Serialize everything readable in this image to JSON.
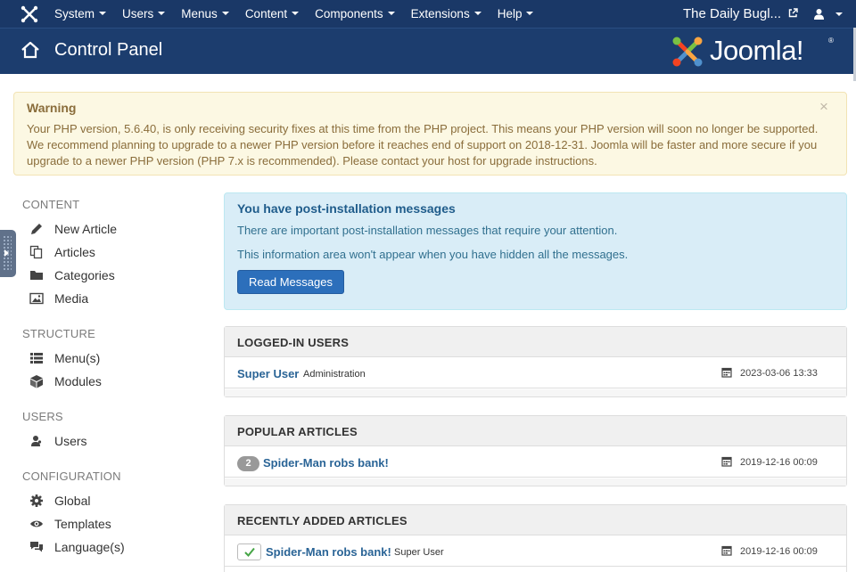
{
  "topbar": {
    "menu": [
      {
        "label": "System"
      },
      {
        "label": "Users"
      },
      {
        "label": "Menus"
      },
      {
        "label": "Content"
      },
      {
        "label": "Components"
      },
      {
        "label": "Extensions"
      },
      {
        "label": "Help"
      }
    ],
    "site_name": "The Daily Bugl...",
    "user_icon": "user-icon",
    "background": "#1a3867"
  },
  "header": {
    "title": "Control Panel",
    "brand": "Joomla!",
    "brand_reg": "®"
  },
  "warning": {
    "title": "Warning",
    "message": "Your PHP version, 5.6.40, is only receiving security fixes at this time from the PHP project. This means your PHP version will soon no longer be supported. We recommend planning to upgrade to a newer PHP version before it reaches end of support on 2018-12-31. Joomla will be faster and more secure if you upgrade to a newer PHP version (PHP 7.x is recommended). Please contact your host for upgrade instructions.",
    "close": "×"
  },
  "sidebar": {
    "content_heading": "CONTENT",
    "content_items": [
      {
        "label": "New Article",
        "icon": "pencil-icon"
      },
      {
        "label": "Articles",
        "icon": "copy-icon"
      },
      {
        "label": "Categories",
        "icon": "folder-icon"
      },
      {
        "label": "Media",
        "icon": "image-icon"
      }
    ],
    "structure_heading": "STRUCTURE",
    "structure_items": [
      {
        "label": "Menu(s)",
        "icon": "list-icon"
      },
      {
        "label": "Modules",
        "icon": "cube-icon"
      }
    ],
    "users_heading": "USERS",
    "users_items": [
      {
        "label": "Users",
        "icon": "users-icon"
      }
    ],
    "config_heading": "CONFIGURATION",
    "config_items": [
      {
        "label": "Global",
        "icon": "cog-icon"
      },
      {
        "label": "Templates",
        "icon": "eye-icon"
      },
      {
        "label": "Language(s)",
        "icon": "comments-icon"
      }
    ]
  },
  "postinstall": {
    "title": "You have post-installation messages",
    "line1": "There are important post-installation messages that require your attention.",
    "line2": "This information area won't appear when you have hidden all the messages.",
    "button": "Read Messages"
  },
  "logged_in": {
    "heading": "LOGGED-IN USERS",
    "rows": [
      {
        "name": "Super User",
        "client": "Administration",
        "date": "2023-03-06 13:33"
      }
    ]
  },
  "popular": {
    "heading": "POPULAR ARTICLES",
    "rows": [
      {
        "hits": "2",
        "title": "Spider-Man robs bank!",
        "date": "2019-12-16 00:09"
      }
    ]
  },
  "recent": {
    "heading": "RECENTLY ADDED ARTICLES",
    "rows": [
      {
        "title": "Spider-Man robs bank!",
        "author": "Super User",
        "date": "2019-12-16 00:09"
      }
    ]
  },
  "colors": {
    "navbar": "#1a3867",
    "header": "#1c3d6e",
    "warning_bg": "#fcf8e3",
    "info_bg": "#d9edf7",
    "primary_button": "#2c6fbb",
    "link": "#2a6496"
  }
}
